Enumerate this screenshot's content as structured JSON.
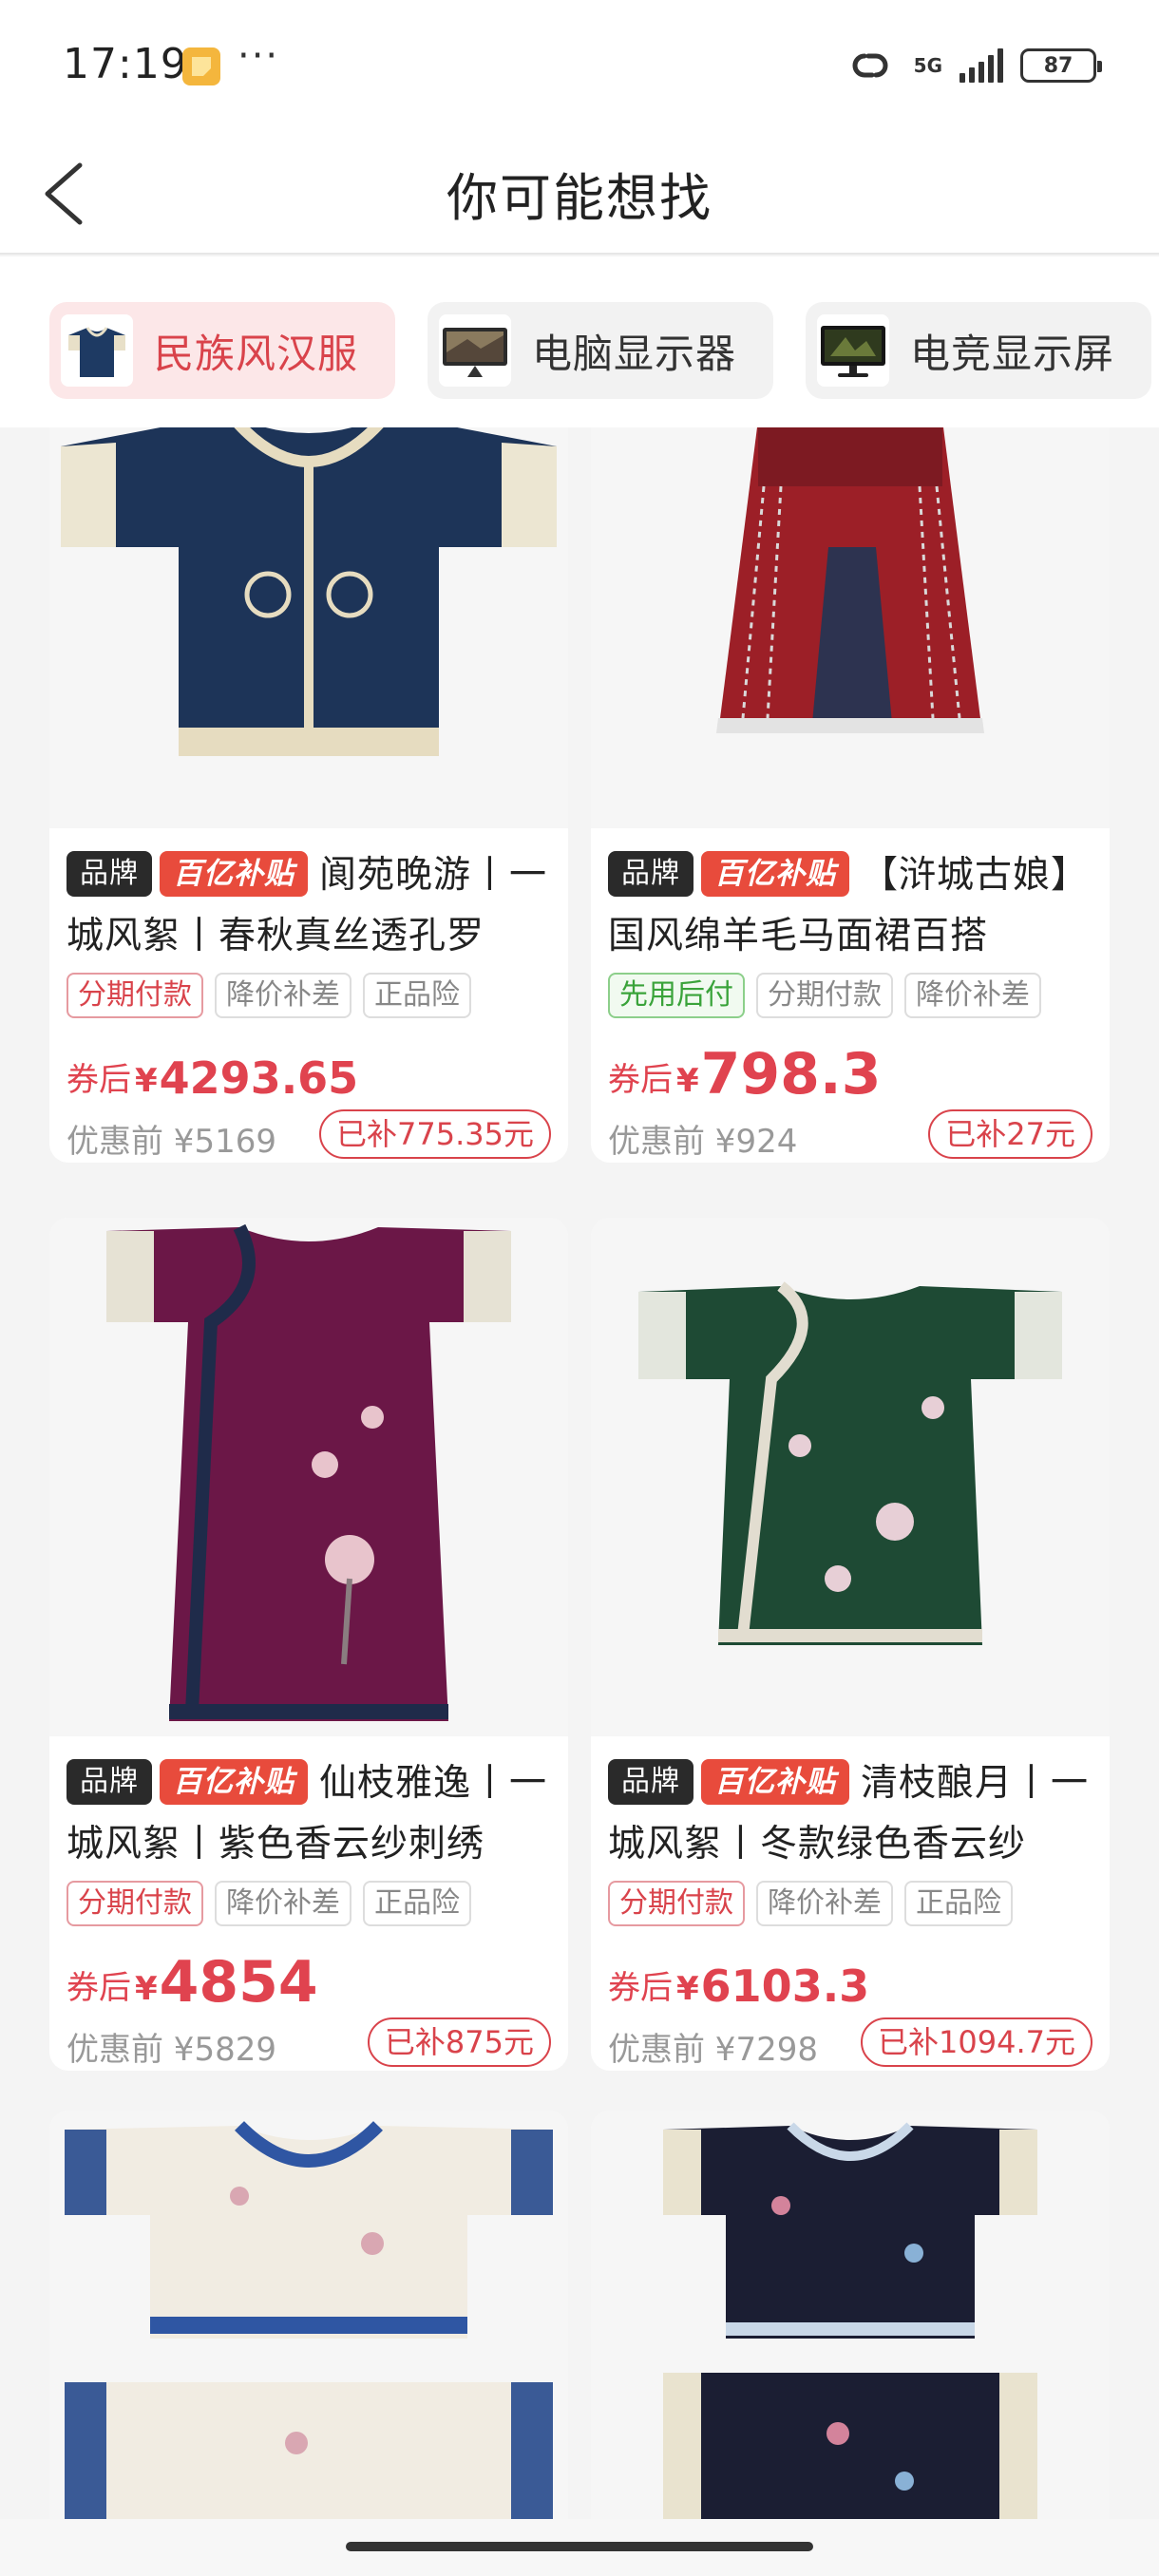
{
  "status_bar": {
    "time": "17:19",
    "more": "···",
    "network": "5G",
    "battery": "87"
  },
  "header": {
    "title": "你可能想找"
  },
  "chips": [
    {
      "label": "民族风汉服",
      "active": true
    },
    {
      "label": "电脑显示器",
      "active": false
    },
    {
      "label": "电竞显示屏",
      "active": false
    }
  ],
  "products": [
    {
      "brand_badge": "品牌",
      "subsidy_badge": "百亿补贴",
      "title": "阆苑晚游丨一城风絮丨春秋真丝透孔罗",
      "tags": [
        "分期付款",
        "降价补差",
        "正品险"
      ],
      "price_prefix": "券后",
      "currency": "¥",
      "price": "4293.65",
      "original_price": "优惠前 ¥5169",
      "saved": "已补775.35元"
    },
    {
      "brand_badge": "品牌",
      "subsidy_badge": "百亿补贴",
      "title": "【浒城古娘】国风绵羊毛马面裙百搭",
      "tags": [
        "先用后付",
        "分期付款",
        "降价补差"
      ],
      "price_prefix": "券后",
      "currency": "¥",
      "price": "798.3",
      "original_price": "优惠前 ¥924",
      "saved": "已补27元"
    },
    {
      "brand_badge": "品牌",
      "subsidy_badge": "百亿补贴",
      "title": "仙枝雅逸丨一城风絮丨紫色香云纱刺绣",
      "tags": [
        "分期付款",
        "降价补差",
        "正品险"
      ],
      "price_prefix": "券后",
      "currency": "¥",
      "price": "4854",
      "original_price": "优惠前 ¥5829",
      "saved": "已补875元"
    },
    {
      "brand_badge": "品牌",
      "subsidy_badge": "百亿补贴",
      "title": "清枝酿月丨一城风絮丨冬款绿色香云纱",
      "tags": [
        "分期付款",
        "降价补差",
        "正品险"
      ],
      "price_prefix": "券后",
      "currency": "¥",
      "price": "6103.3",
      "original_price": "优惠前 ¥7298",
      "saved": "已补1094.7元"
    }
  ],
  "colors": {
    "accent": "#d9434b",
    "subsidy": "#e84b3c",
    "brand_badge": "#2a2a2a"
  }
}
